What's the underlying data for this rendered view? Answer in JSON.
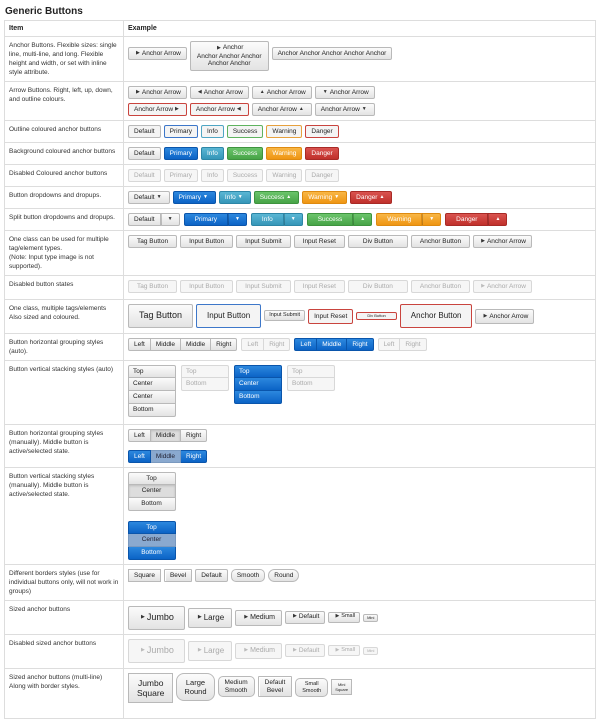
{
  "page_title": "Generic Buttons",
  "headers": {
    "item": "Item",
    "example": "Example"
  },
  "rows": {
    "anchor": {
      "item": "Anchor Buttons. Flexible sizes: single line, multi-line, and long. Flexible height and width, or set with inline style attribute.",
      "b1": "Anchor Arrow",
      "b2a": "Anchor",
      "b2b": "Anchor Anchor Anchor",
      "b2c": "Anchor Anchor",
      "b3": "Anchor Anchor Anchor Anchor Anchor"
    },
    "arrow": {
      "item": "Arrow Buttons. Right, left, up, down, and outline colours.",
      "labels": [
        "Anchor Arrow",
        "Anchor Arrow",
        "Anchor Arrow",
        "Anchor Arrow",
        "Anchor Arrow",
        "Anchor Arrow",
        "Anchor Arrow",
        "Anchor Arrow"
      ]
    },
    "outline": {
      "item": "Outline coloured anchor buttons"
    },
    "background": {
      "item": "Background coloured anchor buttons"
    },
    "disabled_colored": {
      "item": "Disabled Coloured anchor buttons"
    },
    "dropdowns": {
      "item": "Button dropdowns and dropups."
    },
    "split": {
      "item": "Split button dropdowns and dropups."
    },
    "multi_tag": {
      "item": "One class can be used for multiple tag/element types.\n(Note: Input type image is not supported).",
      "labels": [
        "Tag Button",
        "Input Button",
        "Input Submit",
        "Input Reset",
        "Div Button",
        "Anchor Button",
        "Anchor Arrow"
      ]
    },
    "disabled_states": {
      "item": "Disabled button states",
      "labels": [
        "Tag Button",
        "Input Button",
        "Input Submit",
        "Input Reset",
        "Div Button",
        "Anchor Button",
        "Anchor Arrow"
      ]
    },
    "multi_sized": {
      "item": "One class, multiple tags/elements Also sized and coloured.",
      "labels": [
        "Tag Button",
        "Input Button",
        "Input Submit",
        "Input Reset",
        "Div Button",
        "Anchor Button",
        "Anchor Arrow"
      ]
    },
    "hgroup_auto": {
      "item": "Button horizontal grouping styles (auto)."
    },
    "vgroup_auto": {
      "item": "Button vertical stacking styles (auto)"
    },
    "hgroup_manual": {
      "item": "Button horizontal grouping styles (manually). Middle button is active/selected state."
    },
    "vgroup_manual": {
      "item": "Button vertical stacking styles (manually). Middle button is active/selected state."
    },
    "borders": {
      "item": "Different borders styles (use for individual buttons only, will not work in groups)",
      "labels": [
        "Square",
        "Bevel",
        "Default",
        "Smooth",
        "Round"
      ]
    },
    "sized": {
      "item": "Sized anchor buttons"
    },
    "disabled_sized": {
      "item": "Disabled sized anchor buttons"
    },
    "sized_multi": {
      "item": "Sized anchor buttons (multi-line) Along with border styles.",
      "labels": [
        [
          "Jumbo",
          "Square"
        ],
        [
          "Large",
          "Round"
        ],
        [
          "Medium",
          "Smooth"
        ],
        [
          "Default",
          "Bevel"
        ],
        [
          "Small",
          "Smooth"
        ],
        [
          "Mini",
          "Square"
        ]
      ]
    }
  },
  "color_labels": [
    "Default",
    "Primary",
    "Info",
    "Success",
    "Warning",
    "Danger"
  ],
  "group_labels": {
    "left": "Left",
    "middle": "Middle",
    "right": "Right"
  },
  "vstack_labels": {
    "top": "Top",
    "center": "Center",
    "bottom": "Bottom"
  },
  "size_labels": [
    "Jumbo",
    "Large",
    "Medium",
    "Default",
    "Small",
    "Mini"
  ],
  "colors": {
    "primary": "#0b63c6",
    "info": "#3596b8",
    "success": "#47a447",
    "warning": "#ef9513",
    "danger": "#c0302b"
  }
}
